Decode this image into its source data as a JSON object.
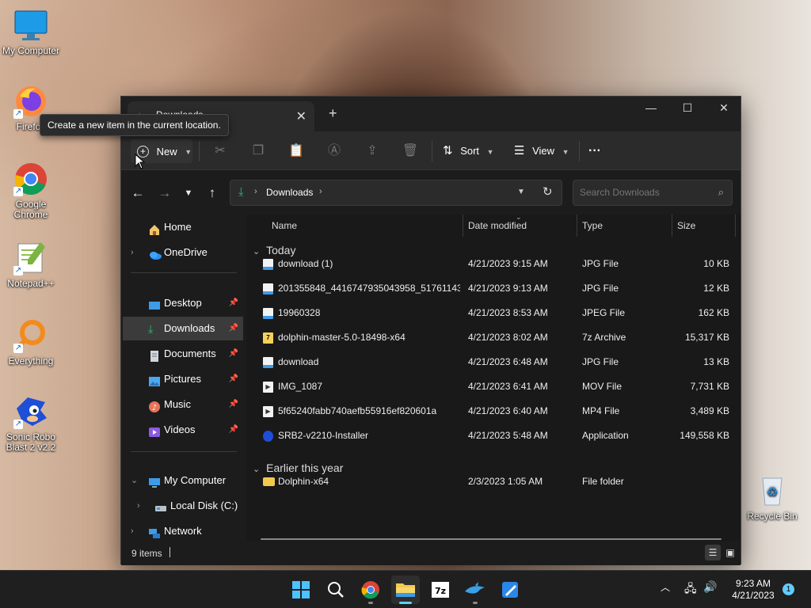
{
  "desktop": {
    "icons": [
      {
        "label": "My Computer",
        "icon": "monitor-icon"
      },
      {
        "label": "Firefox",
        "icon": "firefox-icon"
      },
      {
        "label": "Google Chrome",
        "icon": "chrome-icon"
      },
      {
        "label": "Notepad++",
        "icon": "notepadpp-icon"
      },
      {
        "label": "Everything",
        "icon": "everything-icon"
      },
      {
        "label": "Sonic Robo Blast 2 v2.2",
        "icon": "sonic-icon"
      },
      {
        "label": "Recycle Bin",
        "icon": "recycle-bin-icon"
      }
    ]
  },
  "tooltip": "Create a new item in the current location.",
  "window": {
    "tab_title": "Downloads",
    "controls": {
      "minimize": "—",
      "maximize": "☐",
      "close": "✕"
    },
    "toolbar": {
      "new_label": "New",
      "sort_label": "Sort",
      "view_label": "View",
      "more_label": "···"
    },
    "address": {
      "location": "Downloads",
      "search_placeholder": "Search Downloads"
    },
    "sidebar": {
      "home": "Home",
      "onedrive": "OneDrive",
      "quick": [
        {
          "label": "Desktop"
        },
        {
          "label": "Downloads"
        },
        {
          "label": "Documents"
        },
        {
          "label": "Pictures"
        },
        {
          "label": "Music"
        },
        {
          "label": "Videos"
        }
      ],
      "my_computer": "My Computer",
      "local_disk": "Local Disk (C:)",
      "network": "Network"
    },
    "columns": {
      "name": "Name",
      "date": "Date modified",
      "type": "Type",
      "size": "Size"
    },
    "groups": {
      "today": "Today",
      "earlier": "Earlier this year"
    },
    "files_today": [
      {
        "name": "download (1)",
        "date": "4/21/2023 9:15 AM",
        "type": "JPG File",
        "size": "10 KB"
      },
      {
        "name": "201355848_4416747935043958_517611434...",
        "date": "4/21/2023 9:13 AM",
        "type": "JPG File",
        "size": "12 KB"
      },
      {
        "name": "19960328",
        "date": "4/21/2023 8:53 AM",
        "type": "JPEG File",
        "size": "162 KB"
      },
      {
        "name": "dolphin-master-5.0-18498-x64",
        "date": "4/21/2023 8:02 AM",
        "type": "7z Archive",
        "size": "15,317 KB"
      },
      {
        "name": "download",
        "date": "4/21/2023 6:48 AM",
        "type": "JPG File",
        "size": "13 KB"
      },
      {
        "name": "IMG_1087",
        "date": "4/21/2023 6:41 AM",
        "type": "MOV File",
        "size": "7,731 KB"
      },
      {
        "name": "5f65240fabb740aefb55916ef820601a",
        "date": "4/21/2023 6:40 AM",
        "type": "MP4 File",
        "size": "3,489 KB"
      },
      {
        "name": "SRB2-v2210-Installer",
        "date": "4/21/2023 5:48 AM",
        "type": "Application",
        "size": "149,558 KB"
      }
    ],
    "files_earlier": [
      {
        "name": "Dolphin-x64",
        "date": "2/3/2023 1:05 AM",
        "type": "File folder",
        "size": ""
      }
    ],
    "status": "9 items"
  },
  "taskbar": {
    "clock_time": "9:23 AM",
    "clock_date": "4/21/2023",
    "notification_count": "1"
  }
}
